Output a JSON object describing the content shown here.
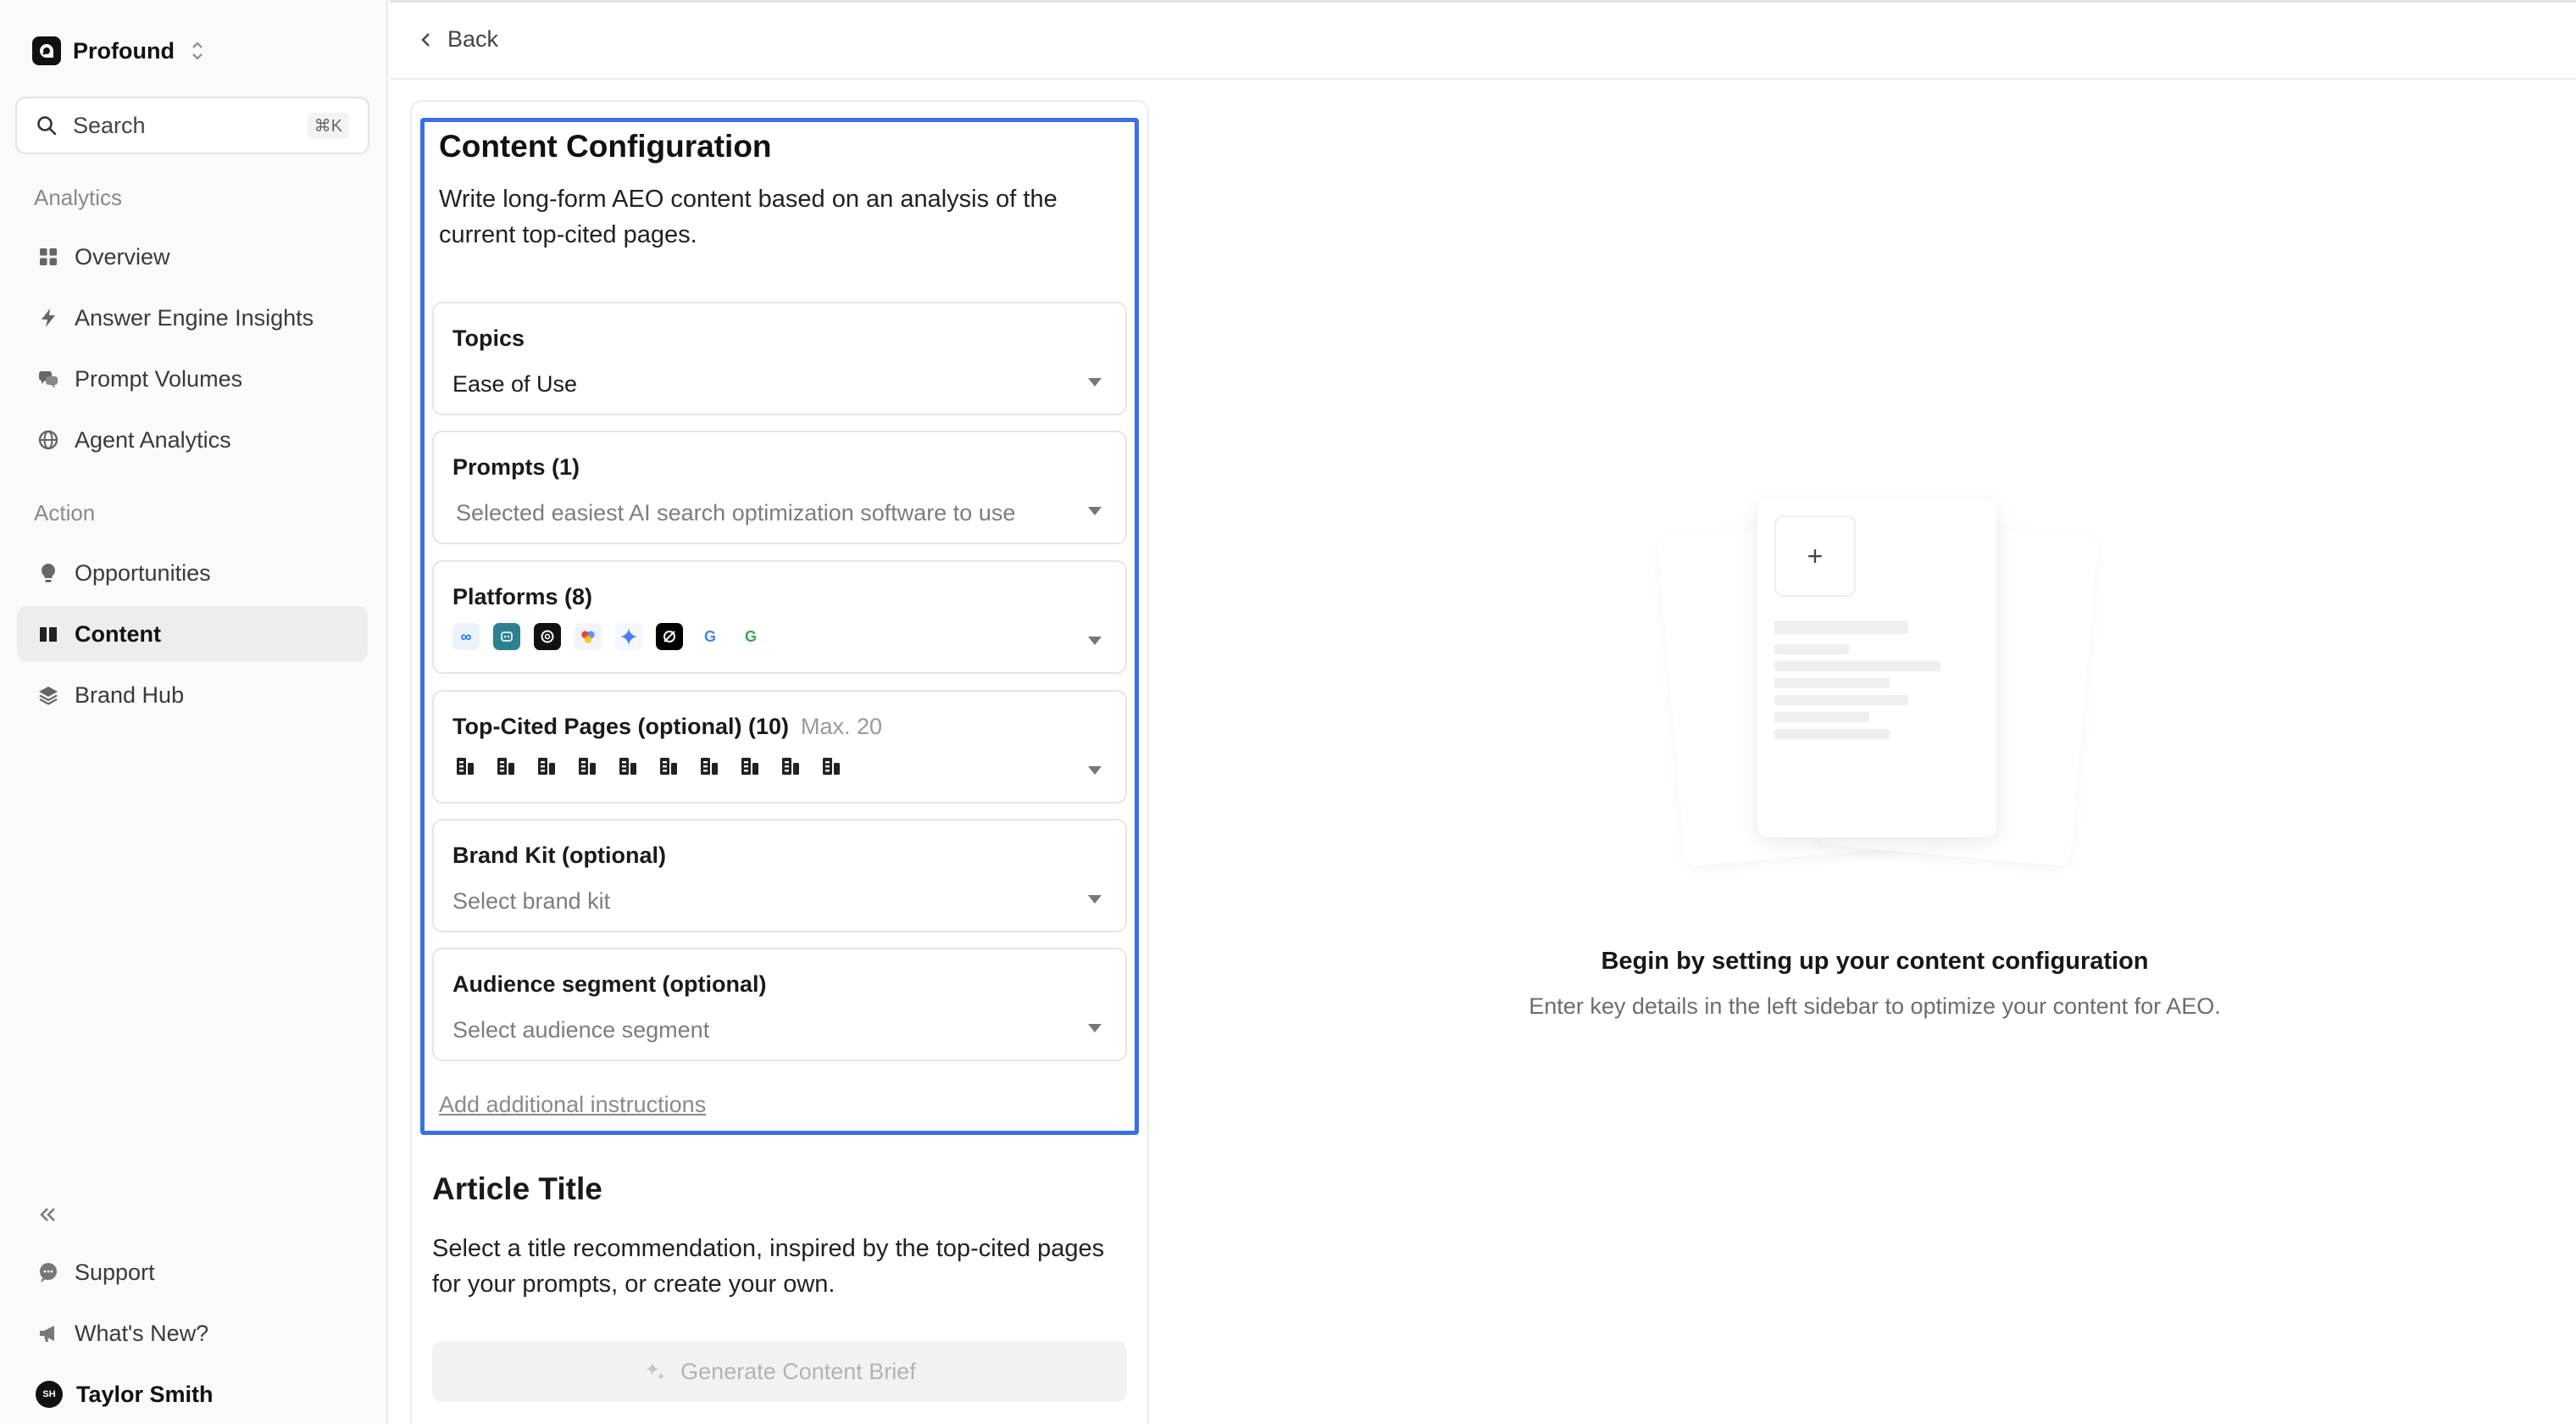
{
  "workspace": {
    "name": "Profound"
  },
  "search": {
    "label": "Search",
    "shortcut": "⌘K"
  },
  "sidebar": {
    "analytics_label": "Analytics",
    "analytics_items": [
      {
        "label": "Overview",
        "icon": "grid-icon"
      },
      {
        "label": "Answer Engine Insights",
        "icon": "bolt-icon"
      },
      {
        "label": "Prompt Volumes",
        "icon": "chat-bubbles-icon"
      },
      {
        "label": "Agent Analytics",
        "icon": "globe-icon"
      }
    ],
    "action_label": "Action",
    "action_items": [
      {
        "label": "Opportunities",
        "icon": "lightbulb-icon"
      },
      {
        "label": "Content",
        "icon": "book-icon",
        "active": true
      },
      {
        "label": "Brand Hub",
        "icon": "layers-icon"
      }
    ],
    "footer": {
      "support": "Support",
      "whats_new": "What's New?",
      "user_name": "Taylor Smith",
      "user_initials": "SH"
    }
  },
  "topbar": {
    "back_label": "Back"
  },
  "config": {
    "title": "Content Configuration",
    "description": "Write long-form AEO content based on an analysis of the current top-cited pages.",
    "fields": {
      "topics": {
        "label": "Topics",
        "value": "Ease of Use"
      },
      "prompts": {
        "label": "Prompts (1)",
        "value": "Selected easiest AI search optimization software to use"
      },
      "platforms": {
        "label": "Platforms (8)",
        "icons": [
          "meta-icon",
          "copilot-icon",
          "chatgpt-icon",
          "ai-overview-icon",
          "gemini-icon",
          "grok-icon",
          "google-icon",
          "google-ai-mode-icon"
        ]
      },
      "pages": {
        "label": "Top-Cited Pages (optional) (10)",
        "hint": "Max. 20",
        "count": 10
      },
      "brand_kit": {
        "label": "Brand Kit (optional)",
        "placeholder": "Select brand kit"
      },
      "audience": {
        "label": "Audience segment (optional)",
        "placeholder": "Select audience segment"
      }
    },
    "add_instructions": "Add additional instructions"
  },
  "article": {
    "title": "Article Title",
    "description": "Select a title recommendation, inspired by the top-cited pages for your prompts, or create your own.",
    "generate_label": "Generate Content Brief"
  },
  "empty_state": {
    "plus": "+",
    "title": "Begin by setting up your content configuration",
    "subtitle": "Enter key details in the left sidebar to optimize your content for AEO."
  },
  "colors": {
    "highlight": "#3b6fe6",
    "active_nav": "#ededed"
  }
}
